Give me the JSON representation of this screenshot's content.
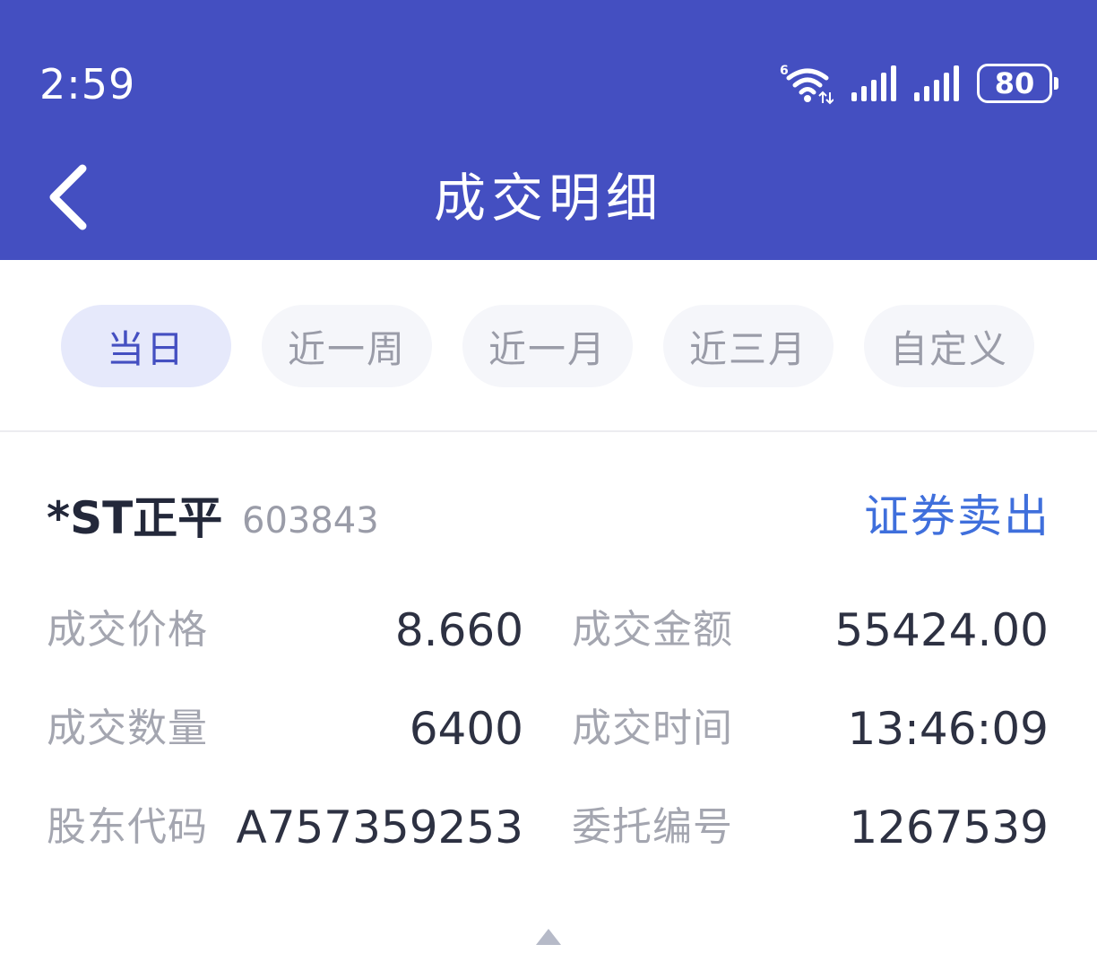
{
  "status_bar": {
    "time": "2:59",
    "wifi_badge": "6",
    "battery": "80"
  },
  "nav": {
    "title": "成交明细"
  },
  "tabs": [
    {
      "label": "当日",
      "active": true
    },
    {
      "label": "近一周",
      "active": false
    },
    {
      "label": "近一月",
      "active": false
    },
    {
      "label": "近三月",
      "active": false
    },
    {
      "label": "自定义",
      "active": false
    }
  ],
  "record": {
    "stock_name": "*ST正平",
    "stock_code": "603843",
    "trade_type": "证券卖出",
    "fields": {
      "price_label": "成交价格",
      "price_value": "8.660",
      "amount_label": "成交金额",
      "amount_value": "55424.00",
      "quantity_label": "成交数量",
      "quantity_value": "6400",
      "time_label": "成交时间",
      "time_value": "13:46:09",
      "holder_label": "股东代码",
      "holder_value": "A757359253",
      "order_label": "委托编号",
      "order_value": "1267539"
    }
  },
  "colors": {
    "header": "#444fc1",
    "tab_active_bg": "#e6e9fb",
    "tab_active_text": "#444fc1",
    "trade_type": "#3f6fdc"
  },
  "icons": {
    "back": "chevron-left-icon",
    "wifi": "wifi-icon",
    "signal": "signal-icon",
    "battery": "battery-icon",
    "expand": "triangle-up-icon"
  }
}
